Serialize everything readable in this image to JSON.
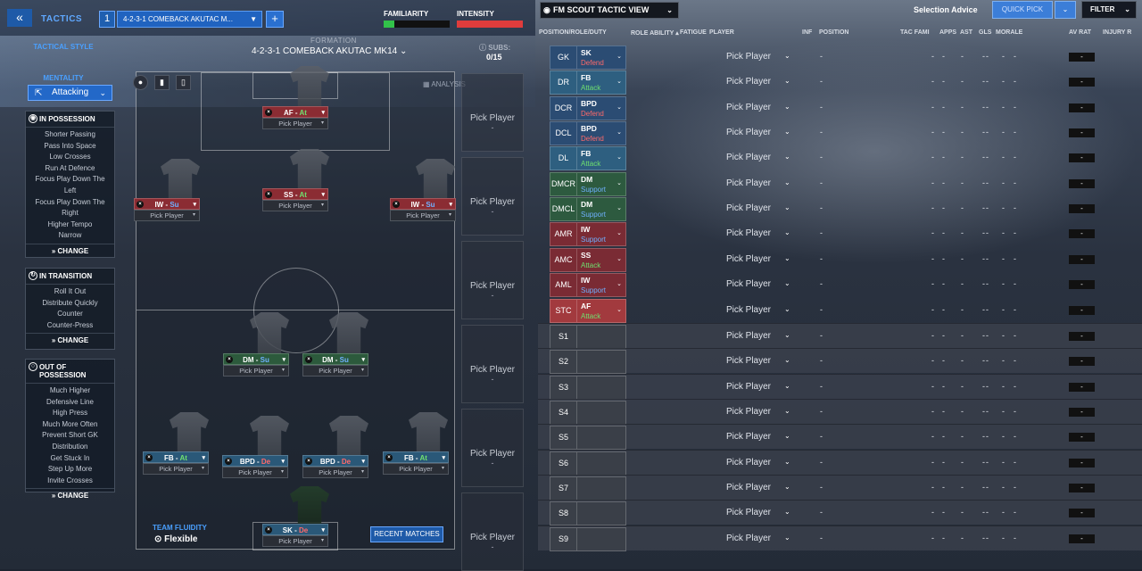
{
  "header": {
    "tactics_label": "TACTICS",
    "tactic_number": "1",
    "tactic_name": "4-2-3-1 COMEBACK AKUTAC M...",
    "familiarity_label": "FAMILIARITY",
    "intensity_label": "INTENSITY"
  },
  "left": {
    "tactical_style_label": "TACTICAL STYLE",
    "mentality_label": "MENTALITY",
    "mentality_value": "Attacking",
    "in_possession": {
      "title": "IN POSSESSION",
      "items": [
        "Shorter Passing",
        "Pass Into Space",
        "Low Crosses",
        "Run At Defence",
        "Focus Play Down The",
        "Left",
        "Focus Play Down The",
        "Right",
        "Higher Tempo",
        "Narrow"
      ],
      "change": "CHANGE"
    },
    "in_transition": {
      "title": "IN TRANSITION",
      "items": [
        "Roll It Out",
        "Distribute Quickly",
        "Counter",
        "Counter-Press"
      ],
      "change": "CHANGE"
    },
    "out_of_possession": {
      "title": "OUT OF POSSESSION",
      "items": [
        "Much Higher",
        "Defensive Line",
        "High Press",
        "Much More Often",
        "Prevent Short GK",
        "Distribution",
        "Get Stuck In",
        "Step Up More",
        "Invite Crosses"
      ],
      "change": "CHANGE"
    }
  },
  "pitch": {
    "formation_label": "FORMATION",
    "formation_value": "4-2-3-1 COMEBACK AKUTAC MK14",
    "subs_label": "SUBS:",
    "subs_value": "0/15",
    "analysis_label": "ANALYSIS",
    "fluidity_label": "TEAM FLUIDITY",
    "fluidity_value": "Flexible",
    "recent_matches": "RECENT MATCHES",
    "pick_player": "Pick Player",
    "players": [
      {
        "role": "AF",
        "duty": "At",
        "color": "red",
        "pick": "Pick Player"
      },
      {
        "role": "IW",
        "duty": "Su",
        "color": "red",
        "pick": "Pick Player"
      },
      {
        "role": "SS",
        "duty": "At",
        "color": "red",
        "pick": "Pick Player"
      },
      {
        "role": "IW",
        "duty": "Su",
        "color": "red",
        "pick": "Pick Player"
      },
      {
        "role": "DM",
        "duty": "Su",
        "color": "green",
        "pick": "Pick Player"
      },
      {
        "role": "DM",
        "duty": "Su",
        "color": "green",
        "pick": "Pick Player"
      },
      {
        "role": "FB",
        "duty": "At",
        "color": "blue",
        "pick": "Pick Player"
      },
      {
        "role": "BPD",
        "duty": "De",
        "color": "blue",
        "pick": "Pick Player"
      },
      {
        "role": "BPD",
        "duty": "De",
        "color": "blue",
        "pick": "Pick Player"
      },
      {
        "role": "FB",
        "duty": "At",
        "color": "blue",
        "pick": "Pick Player"
      },
      {
        "role": "SK",
        "duty": "De",
        "color": "blue",
        "pick": "Pick Player"
      }
    ],
    "sub_slots": [
      {
        "text": "Pick Player",
        "mark": "-"
      },
      {
        "text": "Pick Player",
        "mark": "-"
      },
      {
        "text": "Pick Player",
        "mark": "-"
      },
      {
        "text": "Pick Player",
        "mark": "-"
      },
      {
        "text": "Pick Player",
        "mark": "-"
      },
      {
        "text": "Pick Player",
        "mark": "-"
      }
    ]
  },
  "scout": {
    "view_label": "FM SCOUT TACTIC VIEW",
    "selection_advice": "Selection Advice",
    "quick_pick": "QUICK PICK",
    "filter": "FILTER",
    "columns": {
      "pos": "POSITION/ROLE/DUTY",
      "ra": "ROLE ABILITY",
      "fat": "FATIGUE",
      "player": "PLAYER",
      "inf": "INF",
      "position": "POSITION",
      "tac": "TAC FAMI",
      "apps": "APPS",
      "ast": "AST",
      "gls": "GLS",
      "morale": "MORALE",
      "avrat": "AV RAT",
      "injury": "INJURY R"
    },
    "rows": [
      {
        "pos": "GK",
        "role": "SK",
        "duty": "Defend",
        "color": "c-blue",
        "dclass": "duty-d",
        "player": "Pick Player",
        "avrat": "-"
      },
      {
        "pos": "DR",
        "role": "FB",
        "duty": "Attack",
        "color": "c-ltblue",
        "dclass": "duty-a",
        "player": "Pick Player",
        "avrat": "-"
      },
      {
        "pos": "DCR",
        "role": "BPD",
        "duty": "Defend",
        "color": "c-blue",
        "dclass": "duty-d",
        "player": "Pick Player",
        "avrat": "-"
      },
      {
        "pos": "DCL",
        "role": "BPD",
        "duty": "Defend",
        "color": "c-blue",
        "dclass": "duty-d",
        "player": "Pick Player",
        "avrat": "-"
      },
      {
        "pos": "DL",
        "role": "FB",
        "duty": "Attack",
        "color": "c-ltblue",
        "dclass": "duty-a",
        "player": "Pick Player",
        "avrat": "-"
      },
      {
        "pos": "DMCR",
        "role": "DM",
        "duty": "Support",
        "color": "c-green",
        "dclass": "duty-s",
        "player": "Pick Player",
        "avrat": "-"
      },
      {
        "pos": "DMCL",
        "role": "DM",
        "duty": "Support",
        "color": "c-green",
        "dclass": "duty-s",
        "player": "Pick Player",
        "avrat": "-"
      },
      {
        "pos": "AMR",
        "role": "IW",
        "duty": "Support",
        "color": "c-red",
        "dclass": "duty-s",
        "player": "Pick Player",
        "avrat": "-"
      },
      {
        "pos": "AMC",
        "role": "SS",
        "duty": "Attack",
        "color": "c-red",
        "dclass": "duty-a",
        "player": "Pick Player",
        "avrat": "-"
      },
      {
        "pos": "AML",
        "role": "IW",
        "duty": "Support",
        "color": "c-red",
        "dclass": "duty-s",
        "player": "Pick Player",
        "avrat": "-"
      },
      {
        "pos": "STC",
        "role": "AF",
        "duty": "Attack",
        "color": "c-redhl",
        "dclass": "duty-a",
        "player": "Pick Player",
        "avrat": "-"
      },
      {
        "pos": "S1",
        "role": "",
        "duty": "",
        "color": "c-grey",
        "dclass": "",
        "player": "Pick Player",
        "avrat": "-"
      },
      {
        "pos": "S2",
        "role": "",
        "duty": "",
        "color": "c-grey",
        "dclass": "",
        "player": "Pick Player",
        "avrat": "-"
      },
      {
        "pos": "S3",
        "role": "",
        "duty": "",
        "color": "c-grey",
        "dclass": "",
        "player": "Pick Player",
        "avrat": "-"
      },
      {
        "pos": "S4",
        "role": "",
        "duty": "",
        "color": "c-grey",
        "dclass": "",
        "player": "Pick Player",
        "avrat": "-"
      },
      {
        "pos": "S5",
        "role": "",
        "duty": "",
        "color": "c-grey",
        "dclass": "",
        "player": "Pick Player",
        "avrat": "-"
      },
      {
        "pos": "S6",
        "role": "",
        "duty": "",
        "color": "c-grey",
        "dclass": "",
        "player": "Pick Player",
        "avrat": "-"
      },
      {
        "pos": "S7",
        "role": "",
        "duty": "",
        "color": "c-grey",
        "dclass": "",
        "player": "Pick Player",
        "avrat": "-"
      },
      {
        "pos": "S8",
        "role": "",
        "duty": "",
        "color": "c-grey",
        "dclass": "",
        "player": "Pick Player",
        "avrat": "-"
      },
      {
        "pos": "S9",
        "role": "",
        "duty": "",
        "color": "c-grey",
        "dclass": "",
        "player": "Pick Player",
        "avrat": "-"
      }
    ]
  }
}
